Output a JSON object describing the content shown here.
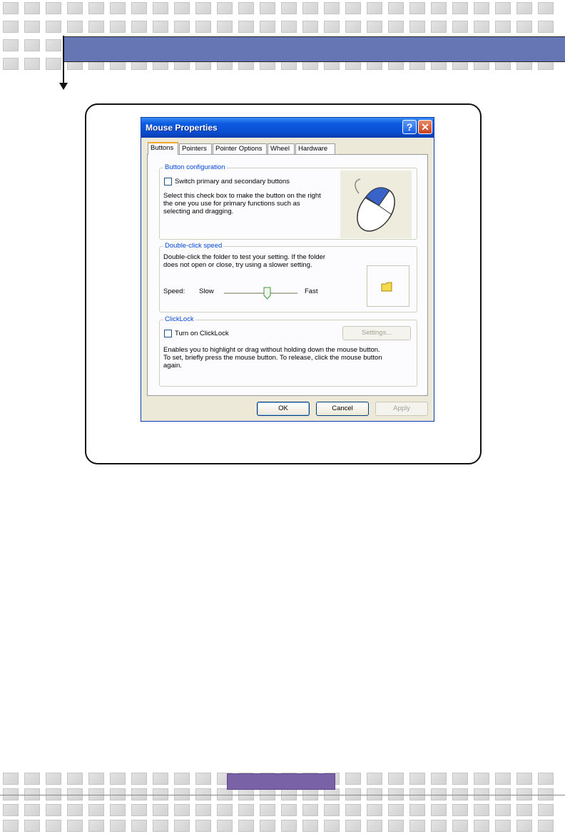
{
  "dialog": {
    "title": "Mouse Properties",
    "help_label": "?",
    "close_label": "✕"
  },
  "tabs": [
    {
      "label": "Buttons"
    },
    {
      "label": "Pointers"
    },
    {
      "label": "Pointer Options"
    },
    {
      "label": "Wheel"
    },
    {
      "label": "Hardware"
    }
  ],
  "button_config": {
    "title": "Button configuration",
    "checkbox_label": "Switch primary and secondary buttons",
    "description_line1": "Select this check box to make the button on the right",
    "description_line2": "the one you use for primary functions such as",
    "description_line3": "selecting and dragging."
  },
  "double_click": {
    "title": "Double-click speed",
    "description_line1": "Double-click the folder to test your setting. If the folder",
    "description_line2": "does not open or close, try using a slower setting.",
    "speed_label": "Speed:",
    "slow_label": "Slow",
    "fast_label": "Fast"
  },
  "clicklock": {
    "title": "ClickLock",
    "checkbox_label": "Turn on ClickLock",
    "settings_label": "Settings...",
    "description_line1": "Enables you to highlight or drag without holding down the mouse button.",
    "description_line2": "To set, briefly press the mouse button. To release, click the mouse button",
    "description_line3": "again."
  },
  "footer_buttons": {
    "ok_label": "OK",
    "cancel_label": "Cancel",
    "apply_label": "Apply"
  },
  "colors": {
    "header_bar": "#6675b4",
    "footer_bar": "#7a62a6",
    "titlebar": "#0a4fd4"
  }
}
